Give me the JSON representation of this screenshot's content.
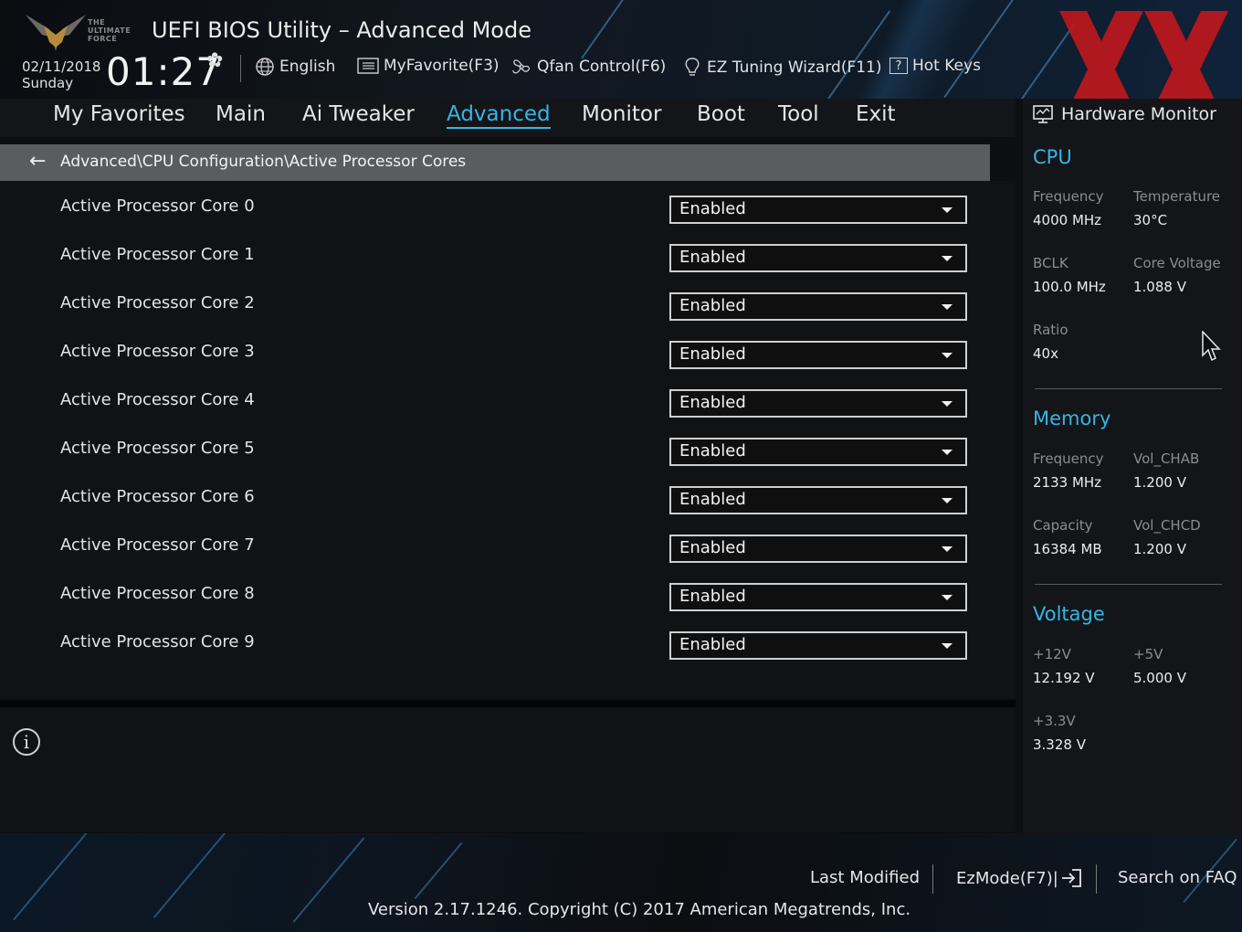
{
  "header": {
    "logo_text": [
      "THE",
      "ULTIMATE",
      "FORCE"
    ],
    "title": "UEFI BIOS Utility – Advanced Mode",
    "date": "02/11/2018",
    "day": "Sunday",
    "time": "01:27",
    "toolbar": {
      "language": "English",
      "my_favorite": "MyFavorite(F3)",
      "qfan": "Qfan Control(F6)",
      "ez_tuning": "EZ Tuning Wizard(F11)",
      "hot_keys": "Hot Keys"
    },
    "icons": [
      "gear-icon",
      "globe-icon",
      "favorite-icon",
      "fan-icon",
      "lightbulb-icon",
      "help-icon"
    ],
    "watermark_color": "#c0181c"
  },
  "tabs": [
    {
      "label": "My Favorites",
      "active": false
    },
    {
      "label": "Main",
      "active": false
    },
    {
      "label": "Ai Tweaker",
      "active": false
    },
    {
      "label": "Advanced",
      "active": true
    },
    {
      "label": "Monitor",
      "active": false
    },
    {
      "label": "Boot",
      "active": false
    },
    {
      "label": "Tool",
      "active": false
    },
    {
      "label": "Exit",
      "active": false
    }
  ],
  "breadcrumb": {
    "path": "Advanced\\CPU Configuration\\Active Processor Cores"
  },
  "settings": [
    {
      "label": "Active Processor Core 0",
      "value": "Enabled"
    },
    {
      "label": "Active Processor Core 1",
      "value": "Enabled"
    },
    {
      "label": "Active Processor Core 2",
      "value": "Enabled"
    },
    {
      "label": "Active Processor Core 3",
      "value": "Enabled"
    },
    {
      "label": "Active Processor Core 4",
      "value": "Enabled"
    },
    {
      "label": "Active Processor Core 5",
      "value": "Enabled"
    },
    {
      "label": "Active Processor Core 6",
      "value": "Enabled"
    },
    {
      "label": "Active Processor Core 7",
      "value": "Enabled"
    },
    {
      "label": "Active Processor Core 8",
      "value": "Enabled"
    },
    {
      "label": "Active Processor Core 9",
      "value": "Enabled"
    }
  ],
  "hardware_monitor": {
    "title": "Hardware Monitor",
    "cpu": {
      "heading": "CPU",
      "frequency_label": "Frequency",
      "frequency": "4000 MHz",
      "temperature_label": "Temperature",
      "temperature": "30°C",
      "bclk_label": "BCLK",
      "bclk": "100.0 MHz",
      "core_voltage_label": "Core Voltage",
      "core_voltage": "1.088 V",
      "ratio_label": "Ratio",
      "ratio": "40x"
    },
    "memory": {
      "heading": "Memory",
      "frequency_label": "Frequency",
      "frequency": "2133 MHz",
      "vol_chab_label": "Vol_CHAB",
      "vol_chab": "1.200 V",
      "capacity_label": "Capacity",
      "capacity": "16384 MB",
      "vol_chcd_label": "Vol_CHCD",
      "vol_chcd": "1.200 V"
    },
    "voltage": {
      "heading": "Voltage",
      "v12_label": "+12V",
      "v12": "12.192 V",
      "v5_label": "+5V",
      "v5": "5.000 V",
      "v33_label": "+3.3V",
      "v33": "3.328 V"
    }
  },
  "footer": {
    "last_modified": "Last Modified",
    "ezmode": "EzMode(F7)|",
    "search_faq": "Search on FAQ",
    "version": "Version 2.17.1246. Copyright (C) 2017 American Megatrends, Inc."
  },
  "colors": {
    "accent": "#35b5e6",
    "breadcrumb_bg": "#5a5c60",
    "panel_bg": "#111214"
  }
}
